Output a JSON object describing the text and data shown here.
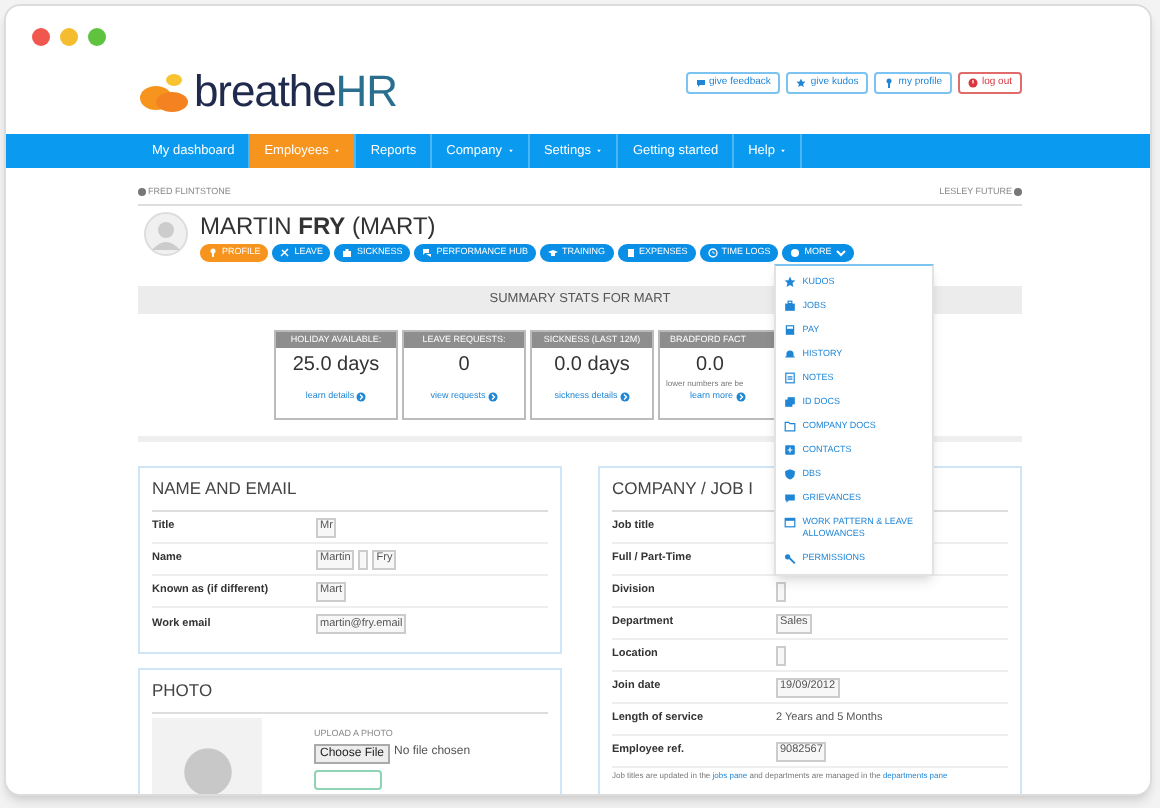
{
  "header": {
    "logo_text": "breathe",
    "logo_accent": "HR",
    "actions": [
      {
        "label": "give feedback",
        "kind": "default"
      },
      {
        "label": "give kudos",
        "kind": "default"
      },
      {
        "label": "my profile",
        "kind": "default"
      },
      {
        "label": "log out",
        "kind": "danger"
      }
    ]
  },
  "nav": [
    {
      "label": "My dashboard",
      "selected": false,
      "has_menu": false
    },
    {
      "label": "Employees",
      "selected": true,
      "has_menu": true
    },
    {
      "label": "Reports",
      "selected": false,
      "has_menu": false
    },
    {
      "label": "Company",
      "selected": false,
      "has_menu": true
    },
    {
      "label": "Settings",
      "selected": false,
      "has_menu": true
    },
    {
      "label": "Getting started",
      "selected": false,
      "has_menu": false
    },
    {
      "label": "Help",
      "selected": false,
      "has_menu": true
    }
  ],
  "employee": {
    "previous": "FRED FLINTSTONE",
    "next": "LESLEY FUTURE",
    "name": "MARTIN **FRY** (MART)"
  },
  "profile_tabs": [
    {
      "label": "PROFILE",
      "selected": true,
      "kind": "tab"
    },
    {
      "label": "LEAVE",
      "selected": false,
      "kind": "tab"
    },
    {
      "label": "SICKNESS",
      "selected": false,
      "kind": "tab"
    },
    {
      "label": "PERFORMANCE HUB",
      "selected": false,
      "kind": "tab"
    },
    {
      "label": "TRAINING",
      "selected": false,
      "kind": "tab"
    },
    {
      "label": "EXPENSES",
      "selected": false,
      "kind": "tab"
    },
    {
      "label": "TIME LOGS",
      "selected": false,
      "kind": "tab"
    },
    {
      "label": "MORE",
      "selected": false,
      "kind": "menu"
    }
  ],
  "more_menu": {
    "expanded": true,
    "items": [
      "KUDOS",
      "JOBS",
      "PAY",
      "HISTORY",
      "NOTES",
      "ID DOCS",
      "COMPANY DOCS",
      "CONTACTS",
      "DBS",
      "GRIEVANCES",
      "WORK PATTERN & LEAVE ALLOWANCES",
      "PERMISSIONS"
    ]
  },
  "summary": {
    "title": "SUMMARY STATS FOR MART",
    "cards": [
      {
        "heading": "HOLIDAY AVAILABLE:",
        "value": "25.0 days",
        "link": "learn details"
      },
      {
        "heading": "LEAVE REQUESTS:",
        "value": "0",
        "link": "view requests"
      },
      {
        "heading": "SICKNESS (LAST 12M)",
        "value": "0.0 days",
        "link": "sickness details"
      },
      {
        "heading": "BRADFORD FACT",
        "value": "0.0",
        "note": "lower numbers are be",
        "link": "learn more"
      }
    ]
  },
  "name_email": {
    "title": "NAME AND EMAIL",
    "rows": [
      {
        "label": "Title",
        "fields": [
          {
            "kind": "text",
            "value": "Mr"
          }
        ]
      },
      {
        "label": "Name",
        "fields": [
          {
            "kind": "text",
            "value": "Martin"
          },
          {
            "kind": "blank"
          },
          {
            "kind": "text",
            "value": "Fry"
          }
        ]
      },
      {
        "label": "Known as (if different)",
        "fields": [
          {
            "kind": "text",
            "value": "Mart"
          }
        ]
      },
      {
        "label": "Work email",
        "fields": [
          {
            "kind": "text",
            "value": "martin@fry.email"
          }
        ]
      }
    ]
  },
  "company_job": {
    "title": "COMPANY / JOB I",
    "rows": [
      {
        "label": "Job title"
      },
      {
        "label": "Full / Part-Time"
      },
      {
        "label": "Division",
        "fields": [
          {
            "kind": "blank"
          }
        ]
      },
      {
        "label": "Department",
        "fields": [
          {
            "kind": "text",
            "value": "Sales"
          }
        ]
      },
      {
        "label": "Location",
        "fields": [
          {
            "kind": "blank"
          }
        ]
      },
      {
        "label": "Join date",
        "fields": [
          {
            "kind": "text",
            "value": "19/09/2012"
          }
        ]
      },
      {
        "label": "Length of service",
        "value": "2 Years and 5 Months"
      },
      {
        "label": "Employee ref.",
        "fields": [
          {
            "kind": "text",
            "value": "9082567"
          }
        ]
      }
    ],
    "note": [
      {
        "kind": "text",
        "text": "Job titles are updated in the "
      },
      {
        "kind": "link",
        "text": "jobs pane"
      },
      {
        "kind": "text",
        "text": " and departments are managed in the "
      },
      {
        "kind": "link",
        "text": "departments pane"
      }
    ]
  },
  "photo": {
    "title": "PHOTO",
    "upload_label": "UPLOAD A PHOTO",
    "button": "Choose File",
    "file_status": "No file chosen"
  }
}
